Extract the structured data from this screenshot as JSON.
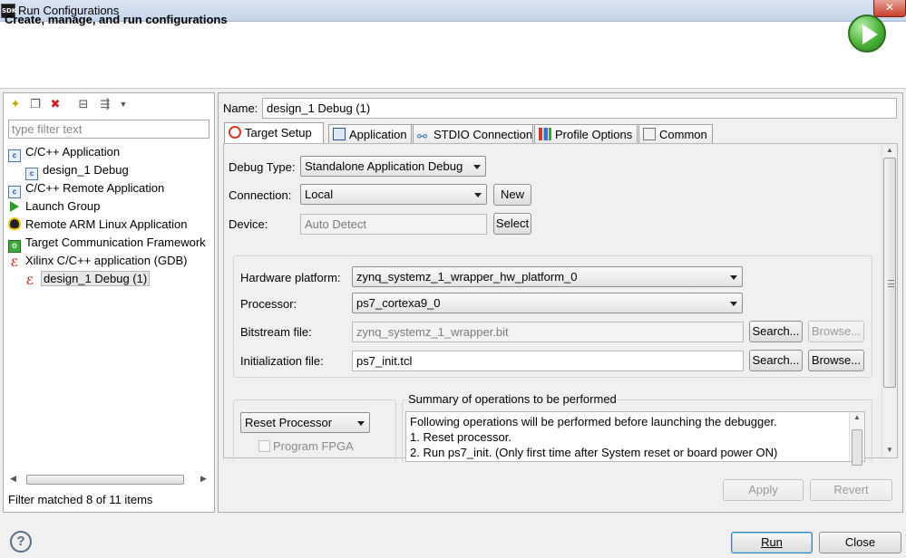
{
  "window": {
    "title": "Run Configurations",
    "app_icon_text": "SDK",
    "close_glyph": "✕"
  },
  "header": {
    "title": "Create, manage, and run configurations"
  },
  "left": {
    "filter_placeholder": "type filter text",
    "tree": [
      {
        "label": "C/C++ Application",
        "icon": "c-app-icon"
      },
      {
        "label": "design_1 Debug",
        "icon": "c-app-icon"
      },
      {
        "label": "C/C++ Remote Application",
        "icon": "c-app-icon"
      },
      {
        "label": "Launch Group",
        "icon": "launch-group-icon"
      },
      {
        "label": "Remote ARM Linux Application",
        "icon": "linux-icon"
      },
      {
        "label": "Target Communication Framework",
        "icon": "tcf-icon"
      },
      {
        "label": "Xilinx C/C++ application (GDB)",
        "icon": "xilinx-gdb-icon"
      },
      {
        "label": "design_1 Debug (1)",
        "icon": "xilinx-gdb-icon",
        "selected": true
      }
    ],
    "status": "Filter matched 8 of 11 items"
  },
  "right": {
    "name_label": "Name:",
    "name_value": "design_1 Debug (1)",
    "tabs": [
      {
        "label": "Target Setup",
        "active": true
      },
      {
        "label": "Application"
      },
      {
        "label": "STDIO Connection"
      },
      {
        "label": "Profile Options"
      },
      {
        "label": "Common"
      }
    ],
    "debug_type_label": "Debug Type:",
    "debug_type_value": "Standalone Application Debug",
    "connection_label": "Connection:",
    "connection_value": "Local",
    "new_button": "New",
    "device_label": "Device:",
    "device_value": "Auto Detect",
    "select_button": "Select",
    "hw_platform_label": "Hardware platform:",
    "hw_platform_value": "zynq_systemz_1_wrapper_hw_platform_0",
    "processor_label": "Processor:",
    "processor_value": "ps7_cortexa9_0",
    "bitstream_label": "Bitstream file:",
    "bitstream_value": "zynq_systemz_1_wrapper.bit",
    "init_label": "Initialization file:",
    "init_value": "ps7_init.tcl",
    "search_button": "Search...",
    "browse_button": "Browse...",
    "reset_value": "Reset Processor",
    "program_fpga_label": "Program FPGA",
    "summary_title": "Summary of operations to be performed",
    "summary_lines": [
      "Following operations will be performed before launching the debugger.",
      "1. Reset processor.",
      "2. Run ps7_init. (Only first time after System reset or board power ON)"
    ],
    "apply_button": "Apply",
    "revert_button": "Revert"
  },
  "footer": {
    "help_glyph": "?",
    "run_button": "Run",
    "close_button": "Close"
  },
  "colors": {
    "accent_green": "#4cb138",
    "xilinx_red": "#c4261c",
    "selection_gray": "#e7e7e7"
  }
}
